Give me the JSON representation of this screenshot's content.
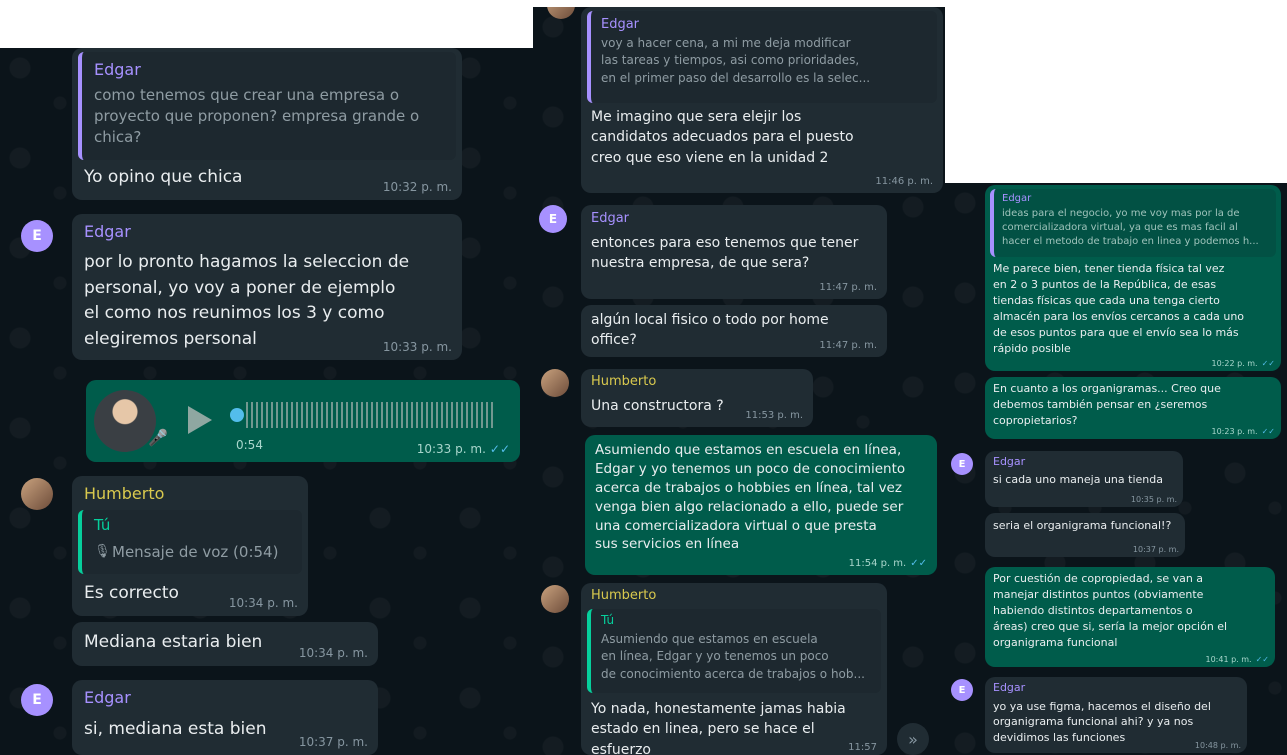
{
  "panel1": {
    "msg_quote": {
      "sender": "Edgar",
      "quote_text": "como tenemos que crear una empresa o\nproyecto que proponen? empresa grande o\nchica?",
      "reply": "Yo opino que chica",
      "time": "10:32 p. m."
    },
    "msg_edgar": {
      "avatar_letter": "E",
      "sender": "Edgar",
      "text": "por lo pronto hagamos la seleccion de\npersonal, yo voy a poner de ejemplo\nel como nos reunimos los 3 y como\nelegiremos personal",
      "time": "10:33 p. m."
    },
    "voice": {
      "duration": "0:54",
      "time": "10:33 p. m.",
      "ticks": "✓✓"
    },
    "msg_humberto": {
      "sender": "Humberto",
      "quote_sender": "Tú",
      "quote_text": "Mensaje de voz (0:54)",
      "text": "Es correcto",
      "time": "10:34 p. m."
    },
    "msg_mediana": {
      "text": "Mediana estaria bien",
      "time": "10:34 p. m."
    },
    "msg_edgar2": {
      "avatar_letter": "E",
      "sender": "Edgar",
      "text": "si, mediana esta bien",
      "time": "10:37 p. m."
    }
  },
  "panel2": {
    "msg_quote": {
      "sender": "Edgar",
      "quote_text": "voy a hacer cena, a mi me deja modificar\nlas tareas y tiempos, asi como prioridades,\nen el primer paso del desarrollo es la selec...",
      "text": "Me imagino que sera elejir los\ncandidatos adecuados para el puesto\ncreo que eso viene en la unidad 2",
      "time": "11:46 p. m."
    },
    "msg_edgar": {
      "avatar_letter": "E",
      "sender": "Edgar",
      "text": "entonces para eso tenemos que tener\nnuestra empresa, de que sera?",
      "time": "11:47 p. m."
    },
    "msg_local": {
      "text": "algún local fisico o todo por home\noffice?",
      "time": "11:47 p. m."
    },
    "msg_humberto": {
      "sender": "Humberto",
      "text": "Una constructora ?",
      "time": "11:53 p. m."
    },
    "msg_out": {
      "text": "Asumiendo que estamos en escuela en línea,\nEdgar y yo tenemos un poco de conocimiento\nacerca de trabajos o hobbies en línea, tal vez\nvenga bien algo relacionado a ello, puede ser\nuna comercializadora virtual o que presta\nsus servicios en línea",
      "time": "11:54 p. m.",
      "ticks": "✓✓"
    },
    "msg_humberto2": {
      "sender": "Humberto",
      "quote_sender": "Tú",
      "quote_text": "Asumiendo que estamos en escuela\nen línea, Edgar y yo tenemos un poco\nde conocimiento acerca de trabajos o hob...",
      "text": "Yo nada, honestamente jamas habia\nestado en linea, pero se hace el\nesfuerzo",
      "time": "11:57"
    },
    "scroll_icon": "chevron-double-down-icon"
  },
  "panel3": {
    "msg_out1": {
      "quote_sender": "Edgar",
      "quote_text": "ideas para el negocio, yo me voy mas por la de\ncomercializadora virtual, ya que es mas facil al\nhacer el metodo de trabajo en linea y podemos h...",
      "text": "Me parece bien, tener tienda física tal vez\nen 2 o 3 puntos de la República, de esas\ntiendas físicas que cada una tenga cierto\nalmacén para los envíos cercanos a cada uno\nde esos puntos para que el envío sea lo más\nrápido posible",
      "time": "10:22 p. m.",
      "ticks": "✓✓"
    },
    "msg_out2": {
      "text": "En cuanto a los organigramas... Creo que\ndebemos también pensar en ¿seremos\ncopropietarios?",
      "time": "10:23 p. m.",
      "ticks": "✓✓"
    },
    "msg_edgar": {
      "avatar_letter": "E",
      "sender": "Edgar",
      "text": "si cada uno maneja una tienda",
      "time": "10:35 p. m."
    },
    "msg_seria": {
      "text": "seria el organigrama funcional!?",
      "time": "10:37 p. m."
    },
    "msg_out3": {
      "text": "Por cuestión de copropiedad, se van a\nmanejar distintos puntos (obviamente\nhabiendo distintos departamentos o\náreas) creo que si, sería la mejor opción el\norganigrama funcional",
      "time": "10:41 p. m.",
      "ticks": "✓✓"
    },
    "msg_edgar2": {
      "avatar_letter": "E",
      "sender": "Edgar",
      "text": "yo ya use figma, hacemos el diseño del\norganigrama funcional ahi? y ya nos\ndevidimos las funciones",
      "time": "10:48 p. m."
    }
  }
}
